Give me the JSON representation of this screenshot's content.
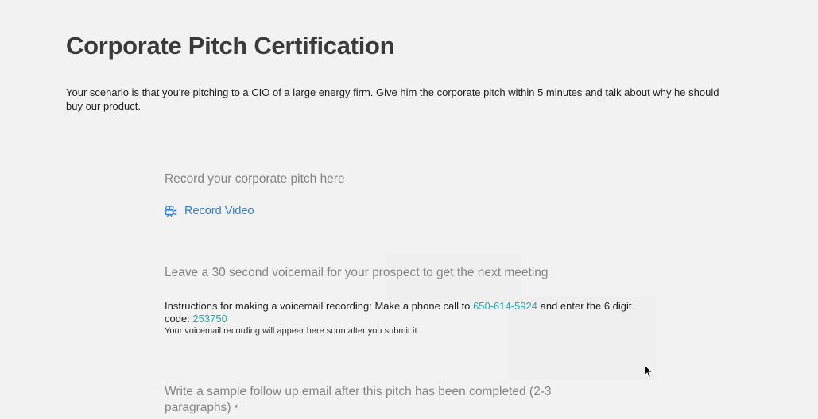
{
  "page": {
    "title": "Corporate Pitch Certification",
    "scenario": "Your scenario is that you're pitching to a CIO of a large energy firm. Give him the corporate pitch within 5 minutes and talk about why he should buy our product."
  },
  "record_section": {
    "label": "Record your corporate pitch here",
    "record_button": "Record Video",
    "icon": "video-camera-icon"
  },
  "voicemail_section": {
    "label": "Leave a 30 second voicemail for your prospect to get the next meeting",
    "instructions_prefix": "Instructions for making a voicemail recording: Make a phone call to ",
    "phone_number": "650-614-5924",
    "instructions_middle": " and enter the 6 digit code: ",
    "code": "253750",
    "note": "Your voicemail recording will appear here soon after you submit it."
  },
  "email_section": {
    "label": "Write a sample follow up email after this pitch has been completed (2-3 paragraphs)",
    "required_marker": "*"
  },
  "colors": {
    "background": "#f2f2f2",
    "link_blue": "#2f7bd6",
    "link_teal": "#1fa9b5",
    "muted_label": "#858585"
  }
}
